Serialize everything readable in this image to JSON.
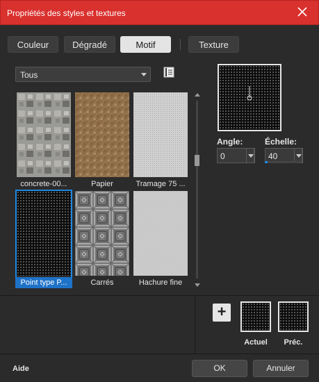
{
  "window": {
    "title": "Propriétés des styles et textures"
  },
  "tabs": [
    {
      "label": "Couleur",
      "active": false
    },
    {
      "label": "Dégradé",
      "active": false
    },
    {
      "label": "Motif",
      "active": true
    },
    {
      "label": "Texture",
      "active": false
    }
  ],
  "category_dropdown": {
    "value": "Tous"
  },
  "patterns": [
    {
      "label": "concrete-00...",
      "pattern": "concrete"
    },
    {
      "label": "Papier",
      "pattern": "paper"
    },
    {
      "label": "Tramage 75 ...",
      "pattern": "tramage"
    },
    {
      "label": "Point type P...",
      "pattern": "dots",
      "selected": true
    },
    {
      "label": "Carrés",
      "pattern": "squares"
    },
    {
      "label": "Hachure fine",
      "pattern": "hatch"
    }
  ],
  "controls": {
    "angle": {
      "label": "Angle:",
      "value": "0"
    },
    "scale": {
      "label": "Échelle:",
      "value": "40",
      "slider_percent": 4
    }
  },
  "swatches": {
    "current_label": "Actuel",
    "previous_label": "Préc."
  },
  "add_button": {
    "label": "+"
  },
  "footer": {
    "help_label": "Aide",
    "ok_label": "OK",
    "cancel_label": "Annuler"
  },
  "colors": {
    "title_bar": "#d9312e",
    "selection": "#1e72c8",
    "background": "#2b2b2b"
  }
}
